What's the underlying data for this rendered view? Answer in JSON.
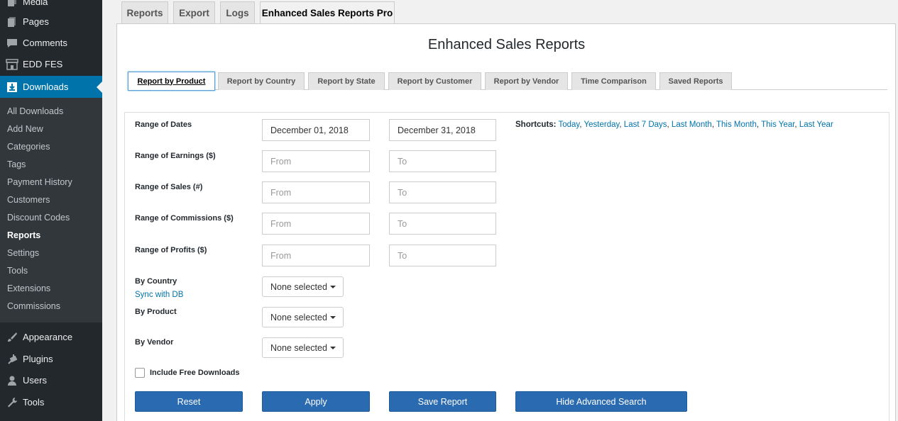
{
  "sidebar": {
    "menu": [
      {
        "label": "Media",
        "icon": "media-icon"
      },
      {
        "label": "Pages",
        "icon": "pages-icon"
      },
      {
        "label": "Comments",
        "icon": "comments-icon"
      },
      {
        "label": "EDD FES",
        "icon": "store-icon"
      },
      {
        "label": "Downloads",
        "icon": "download-icon"
      },
      {
        "label": "Appearance",
        "icon": "paintbrush-icon"
      },
      {
        "label": "Plugins",
        "icon": "plugin-icon"
      },
      {
        "label": "Users",
        "icon": "users-icon"
      },
      {
        "label": "Tools",
        "icon": "wrench-icon"
      }
    ],
    "submenu": [
      "All Downloads",
      "Add New",
      "Categories",
      "Tags",
      "Payment History",
      "Customers",
      "Discount Codes",
      "Reports",
      "Settings",
      "Tools",
      "Extensions",
      "Commissions"
    ],
    "active_menu": "Downloads",
    "current_submenu": "Reports"
  },
  "top_tabs": [
    "Reports",
    "Export",
    "Logs",
    "Enhanced Sales Reports Pro"
  ],
  "active_top_tab": "Enhanced Sales Reports Pro",
  "page_title": "Enhanced Sales Reports",
  "report_tabs": [
    "Report by Product",
    "Report by Country",
    "Report by State",
    "Report by Customer",
    "Report by Vendor",
    "Time Comparison",
    "Saved Reports"
  ],
  "active_report_tab": "Report by Product",
  "form": {
    "range_dates_label": "Range of Dates",
    "date_from": "December 01, 2018",
    "date_to": "December 31, 2018",
    "shortcuts_label": "Shortcuts:",
    "shortcuts": [
      "Today",
      "Yesterday",
      "Last 7 Days",
      "Last Month",
      "This Month",
      "This Year",
      "Last Year"
    ],
    "ranges": [
      {
        "label": "Range of Earnings ($)",
        "from": "From",
        "to": "To"
      },
      {
        "label": "Range of Sales (#)",
        "from": "From",
        "to": "To"
      },
      {
        "label": "Range of Commissions ($)",
        "from": "From",
        "to": "To"
      },
      {
        "label": "Range of Profits ($)",
        "from": "From",
        "to": "To"
      }
    ],
    "by_country_label": "By Country",
    "sync_link": "Sync with DB",
    "by_product_label": "By Product",
    "by_vendor_label": "By Vendor",
    "select_value": "None selected",
    "include_free_label": "Include Free Downloads",
    "buttons": {
      "reset": "Reset",
      "apply": "Apply",
      "save": "Save Report",
      "hide": "Hide Advanced Search"
    }
  },
  "colors": {
    "accent": "#0073aa",
    "sidebar_bg": "#23282d",
    "submenu_bg": "#32373c",
    "button_bg": "#2a6ab0"
  }
}
